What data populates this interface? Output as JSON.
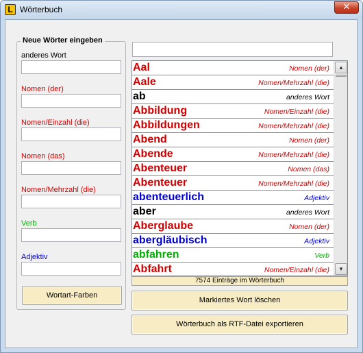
{
  "window": {
    "title": "Wörterbuch",
    "close_glyph": "✕",
    "app_icon_glyph": "L"
  },
  "entry_group": {
    "title": "Neue Wörter eingeben",
    "fields": [
      {
        "label": "anderes Wort",
        "color": "#000000",
        "value": ""
      },
      {
        "label": "Nomen (der)",
        "color": "#d00000",
        "value": ""
      },
      {
        "label": "Nomen/Einzahl (die)",
        "color": "#d00000",
        "value": ""
      },
      {
        "label": "Nomen (das)",
        "color": "#d00000",
        "value": ""
      },
      {
        "label": "Nomen/Mehrzahl (die)",
        "color": "#d00000",
        "value": ""
      },
      {
        "label": "Verb",
        "color": "#00b000",
        "value": ""
      },
      {
        "label": "Adjektiv",
        "color": "#0000d0",
        "value": ""
      }
    ],
    "colors_button": "Wortart-Farben"
  },
  "search": {
    "value": ""
  },
  "words": [
    {
      "word": "Aal",
      "pos": "Nomen (der)",
      "color": "#d00000"
    },
    {
      "word": "Aale",
      "pos": "Nomen/Mehrzahl (die)",
      "color": "#d00000"
    },
    {
      "word": "ab",
      "pos": "anderes Wort",
      "color": "#000000"
    },
    {
      "word": "Abbildung",
      "pos": "Nomen/Einzahl (die)",
      "color": "#d00000"
    },
    {
      "word": "Abbildungen",
      "pos": "Nomen/Mehrzahl (die)",
      "color": "#d00000"
    },
    {
      "word": "Abend",
      "pos": "Nomen (der)",
      "color": "#d00000"
    },
    {
      "word": "Abende",
      "pos": "Nomen/Mehrzahl (die)",
      "color": "#d00000"
    },
    {
      "word": "Abenteuer",
      "pos": "Nomen (das)",
      "color": "#d00000"
    },
    {
      "word": "Abenteuer",
      "pos": "Nomen/Mehrzahl (die)",
      "color": "#d00000"
    },
    {
      "word": "abenteuerlich",
      "pos": "Adjektiv",
      "color": "#0000d0"
    },
    {
      "word": "aber",
      "pos": "anderes Wort",
      "color": "#000000"
    },
    {
      "word": "Aberglaube",
      "pos": "Nomen (der)",
      "color": "#d00000"
    },
    {
      "word": "abergläubisch",
      "pos": "Adjektiv",
      "color": "#0000d0"
    },
    {
      "word": "abfahren",
      "pos": "Verb",
      "color": "#00b000"
    },
    {
      "word": "Abfahrt",
      "pos": "Nomen/Einzahl (die)",
      "color": "#d00000"
    }
  ],
  "scrollbar": {
    "up_glyph": "▲",
    "down_glyph": "▼"
  },
  "status": {
    "count_text": "7574 Einträge im Wörterbuch"
  },
  "actions": {
    "delete_label": "Markiertes Wort löschen",
    "export_label": "Wörterbuch als RTF-Datei exportieren"
  }
}
